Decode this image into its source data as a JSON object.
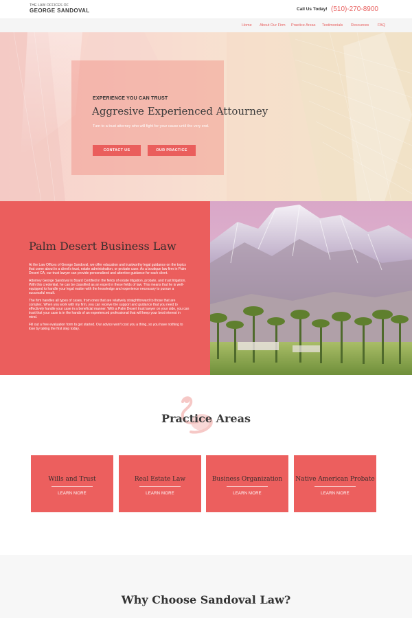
{
  "header": {
    "logo_small": "THE LAW OFFICES OF",
    "logo_big": "GEORGE SANDOVAL",
    "call_label": "Call Us Today!",
    "phone": "(510)-270-8900"
  },
  "nav": {
    "items": [
      "Home",
      "About Our Firm",
      "Practice Areas",
      "Testimonials",
      "Resources",
      "FAQ"
    ]
  },
  "hero": {
    "eyebrow": "EXPERIENCE YOU CAN TRUST",
    "title": "Aggresive Experienced Attourney",
    "subtitle": "Turn to a trust attorney who will fight for your cause until the very end.",
    "button_contact": "CONTACT US",
    "button_practice": "OUR PRACTICE"
  },
  "business": {
    "title": "Palm Desert Business Law",
    "paragraphs": [
      "At the Law Offices of George Sandoval, we offer education and trustworthy legal guidance on the topics that come about in a client's trust, estate administration, or probate case. As a boutique law firm in Palm Desert CA, our trust lawyer can provide personalized and attentive guidance for each client.",
      "Attorney George Sandoval is Board Certified in the fields of estate litigation, probate, and trust litigation. With this credential, he can be classified as an expert in these fields of law. This means that he is well-equipped to handle your legal matter with the knowledge and experience necessary to pursue a successful result.",
      "The firm handles all types of cases, from ones that are relatively straightforward to those that are complex. When you work with my firm, you can receive the support and guidance that you need to effectively handle your case in a beneficial manner. With a Palm Desert trust lawyer on your side, you can trust that your case is in the hands of an experienced professional that will keep your best interest in mind.",
      "Fill out a free evaluation form to get started. Our advice won't cost you a thing, so you have nothing to lose by taking the first step today."
    ]
  },
  "practice": {
    "title": "Practice Areas",
    "learn_more": "LEARN MORE",
    "cards": [
      "Wills and Trust",
      "Real Estate Law",
      "Business Organization",
      "Native American Probate"
    ]
  },
  "why": {
    "title": "Why Choose Sandoval Law?"
  },
  "icons": {
    "practice_icon": "flamingo-icon"
  },
  "colors": {
    "accent": "#ea5e5c",
    "nav_bg": "#f5f5f5",
    "section_bg": "#f7f7f7"
  }
}
